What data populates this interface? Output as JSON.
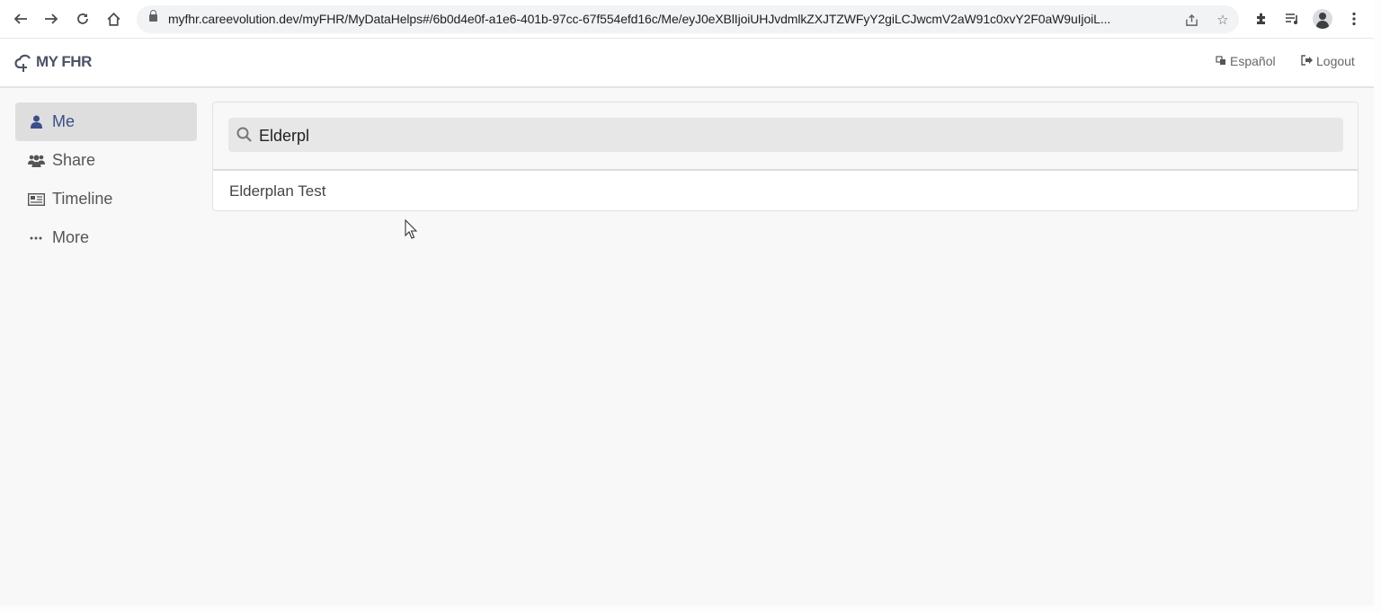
{
  "browser": {
    "url": "myfhr.careevolution.dev/myFHR/MyDataHelps#/6b0d4e0f-a1e6-401b-97cc-67f554efd16c/Me/eyJ0eXBlIjoiUHJvdmlkZXJTZWFyY2giLCJwcmV2aW91c0xvY2F0aW9uIjoiL...",
    "icons": {
      "back": "back-arrow-icon",
      "forward": "forward-arrow-icon",
      "reload": "reload-icon",
      "home": "home-icon",
      "lock": "lock-icon",
      "share": "share-icon",
      "bookmark": "star-icon",
      "extensions": "puzzle-icon",
      "media": "media-queue-icon",
      "profile": "profile-avatar-icon",
      "menu": "kebab-menu-icon"
    }
  },
  "header": {
    "logo_text": "MY FHR",
    "language_label": "Español",
    "logout_label": "Logout"
  },
  "sidebar": {
    "items": [
      {
        "label": "Me",
        "icon": "user-icon",
        "active": true
      },
      {
        "label": "Share",
        "icon": "users-icon",
        "active": false
      },
      {
        "label": "Timeline",
        "icon": "timeline-card-icon",
        "active": false
      },
      {
        "label": "More",
        "icon": "ellipsis-icon",
        "active": false
      }
    ]
  },
  "search": {
    "value": "Elderpl",
    "results": [
      {
        "label": "Elderplan Test"
      }
    ]
  },
  "colors": {
    "active_accent": "#3a4f8a",
    "active_bg": "#dedede",
    "page_bg": "#f8f8f8"
  }
}
